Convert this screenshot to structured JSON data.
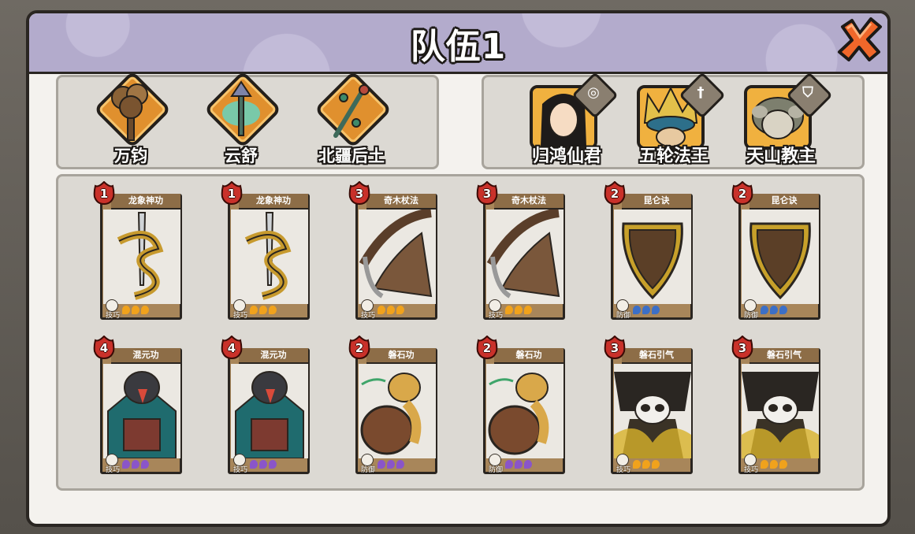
{
  "title": "队伍1",
  "relics": [
    {
      "name": "万钧",
      "icon": "hammer-relic-icon"
    },
    {
      "name": "云舒",
      "icon": "cloud-staff-relic-icon"
    },
    {
      "name": "北疆后土",
      "icon": "beaded-staff-relic-icon"
    }
  ],
  "heroes": [
    {
      "name": "归鸿仙君",
      "role_icon": "swirl-icon"
    },
    {
      "name": "五轮法王",
      "role_icon": "sword-icon"
    },
    {
      "name": "天山教主",
      "role_icon": "shield-icon"
    }
  ],
  "cards": [
    {
      "cost": "1",
      "name": "龙象神功",
      "type": "技巧",
      "element": "gold",
      "art": "dragon-sword"
    },
    {
      "cost": "1",
      "name": "龙象神功",
      "type": "技巧",
      "element": "gold",
      "art": "dragon-sword"
    },
    {
      "cost": "3",
      "name": "奇木杖法",
      "type": "技巧",
      "element": "gold",
      "art": "brush"
    },
    {
      "cost": "3",
      "name": "奇木杖法",
      "type": "技巧",
      "element": "gold",
      "art": "brush"
    },
    {
      "cost": "2",
      "name": "昆仑诀",
      "type": "防御",
      "element": "blue",
      "art": "shield"
    },
    {
      "cost": "2",
      "name": "昆仑诀",
      "type": "防御",
      "element": "blue",
      "art": "shield"
    },
    {
      "cost": "4",
      "name": "混元功",
      "type": "技巧",
      "element": "purple",
      "art": "bird"
    },
    {
      "cost": "4",
      "name": "混元功",
      "type": "技巧",
      "element": "purple",
      "art": "bird"
    },
    {
      "cost": "2",
      "name": "磐石功",
      "type": "防御",
      "element": "purple",
      "art": "turtle"
    },
    {
      "cost": "2",
      "name": "磐石功",
      "type": "防御",
      "element": "purple",
      "art": "turtle"
    },
    {
      "cost": "3",
      "name": "磐石引气",
      "type": "技巧",
      "element": "gold",
      "art": "panda"
    },
    {
      "cost": "3",
      "name": "磐石引气",
      "type": "技巧",
      "element": "gold",
      "art": "panda"
    }
  ],
  "colors": {
    "gold": "#f0a21c",
    "blue": "#3c6fc6",
    "purple": "#8a55c9",
    "title_bar": "#b3abcc",
    "panel": "#f4f2ee",
    "close": "#f0672a"
  }
}
